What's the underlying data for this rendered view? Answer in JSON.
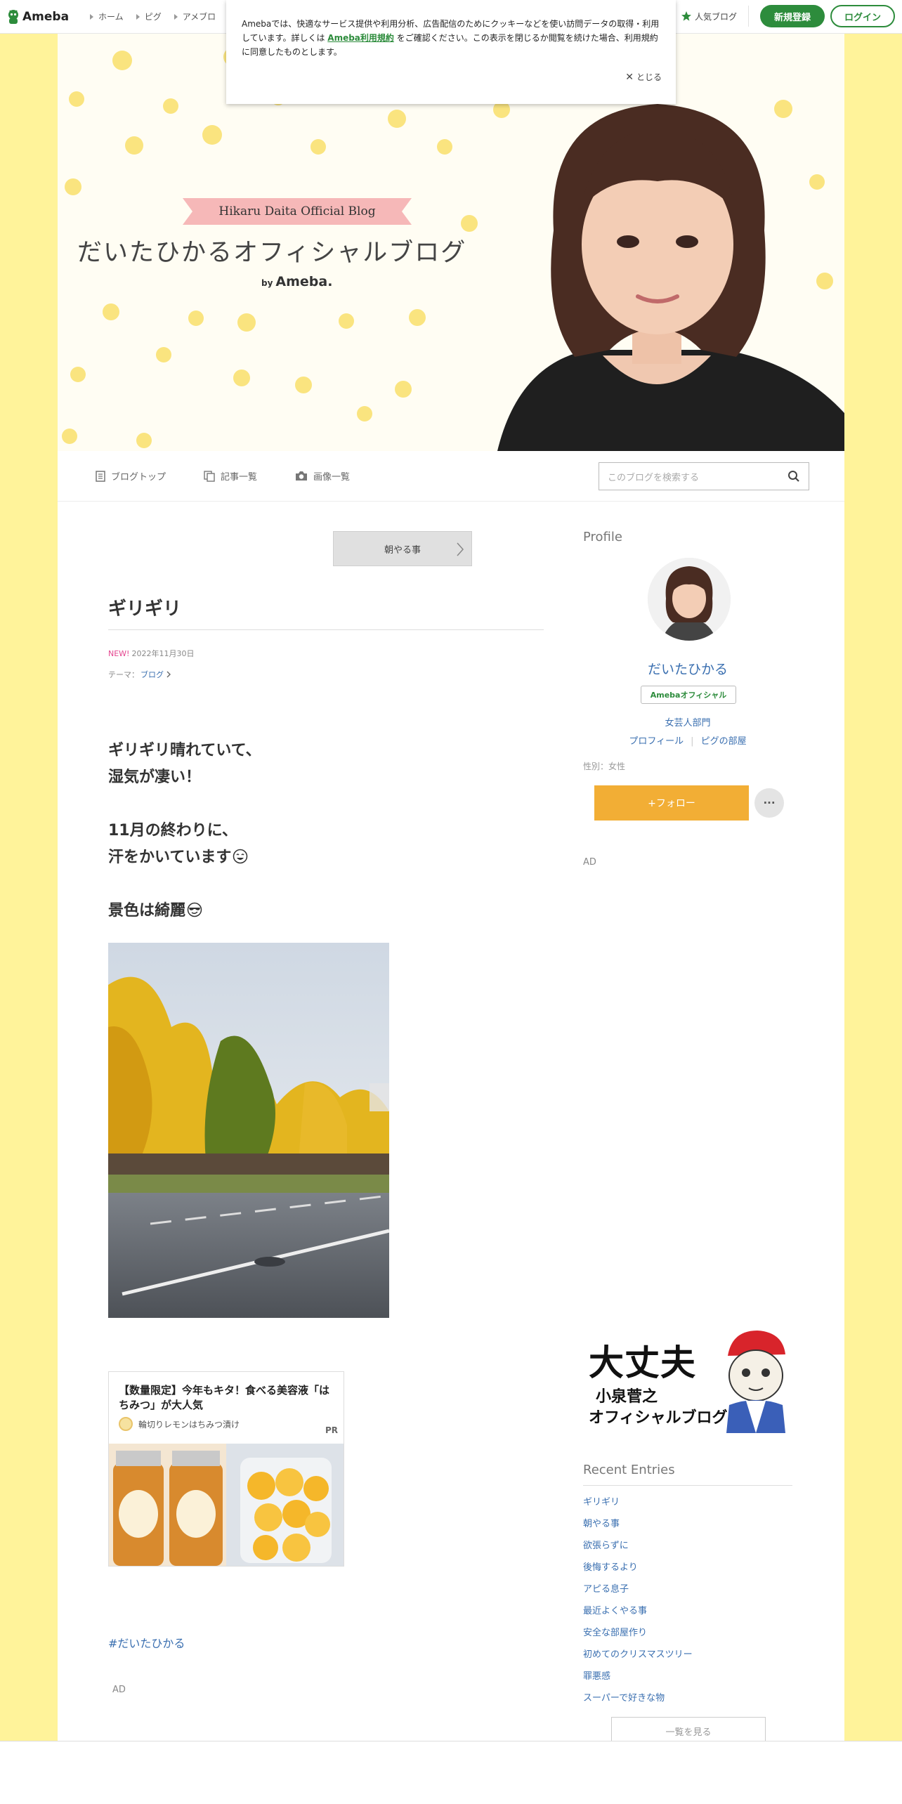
{
  "topbar": {
    "logo": "Ameba",
    "nav": [
      "ホーム",
      "ピグ",
      "アメブロ"
    ],
    "popular": "人気ブログ",
    "signup": "新規登録",
    "login": "ログイン"
  },
  "cookie": {
    "text1": "Amebaでは、快適なサービス提供や利用分析、広告配信のためにクッキーなどを使い訪問データの取得・利用しています。詳しくは",
    "link": "Ameba利用規約",
    "text2": "をご確認ください。この表示を閉じるか閲覧を続けた場合、利用規約に同意したものとします。",
    "close": "とじる"
  },
  "hero": {
    "ribbon": "Hikaru Daita Official Blog",
    "title": "だいたひかるオフィシャルブログ",
    "by": "by",
    "brand": "Ameba."
  },
  "blognav": {
    "top": "ブログトップ",
    "entries": "記事一覧",
    "images": "画像一覧",
    "search_placeholder": "このブログを検索する"
  },
  "entry": {
    "prev": "朝やる事",
    "title": "ギリギリ",
    "new": "NEW!",
    "date": "2022年11月30日",
    "theme_label": "テーマ：",
    "theme": "ブログ",
    "lines": [
      "ギリギリ晴れていて、",
      "湿気が凄い！",
      "11月の終わりに、",
      "汗をかいています",
      "景色は綺麗"
    ],
    "hashtag": "#だいたひかる",
    "ad": "AD"
  },
  "pr": {
    "title": "【数量限定】今年もキタ！食べる美容液「はちみつ」が大人気",
    "source": "輪切りレモンはちみつ漬け",
    "badge": "PR"
  },
  "sidebar": {
    "heading": "Profile",
    "name": "だいたひかる",
    "official": "Amebaオフィシャル",
    "category": "女芸人部門",
    "link_profile": "プロフィール",
    "link_room": "ピグの部屋",
    "gender": "性別：女性",
    "follow": "+フォロー",
    "more": "···",
    "ad": "AD",
    "banner": {
      "line1": "大丈夫",
      "line2": "小泉菅之",
      "line3": "オフィシャルブログ"
    },
    "recent_heading": "Recent Entries",
    "recent": [
      "ギリギリ",
      "朝やる事",
      "欲張らずに",
      "後悔するより",
      "アピる息子",
      "最近よくやる事",
      "安全な部屋作り",
      "初めてのクリスマスツリー",
      "罪悪感",
      "スーパーで好きな物"
    ],
    "see_all": "一覧を見る"
  },
  "colors": {
    "brand_green": "#2d8c3c",
    "link_blue": "#3a6fb0",
    "follow_orange": "#f2ae35",
    "side_yellow": "#fff39a"
  }
}
